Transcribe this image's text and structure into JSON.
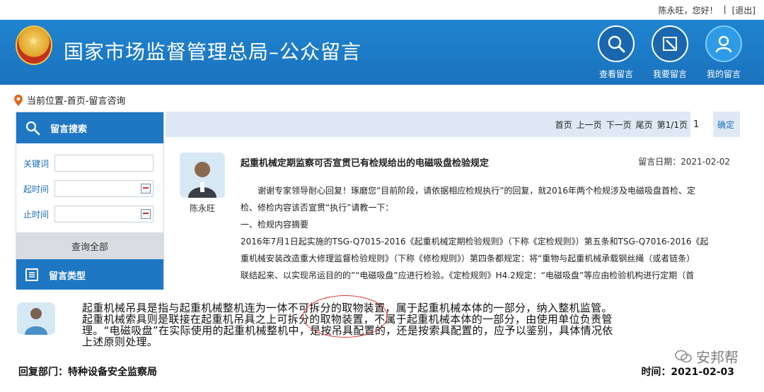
{
  "topbar": {
    "greeting": "陈永旺，您好！",
    "separator": "|",
    "logout": "[退出]"
  },
  "header": {
    "site_title": "国家市场监督管理总局–公众留言",
    "nav": [
      {
        "label": "查看留言",
        "icon": "search-icon"
      },
      {
        "label": "我要留言",
        "icon": "edit-icon"
      },
      {
        "label": "我的留言",
        "icon": "user-icon"
      }
    ]
  },
  "breadcrumb": {
    "text": "当前位置-首页-留言咨询"
  },
  "sidebar": {
    "search_title": "留言搜索",
    "keyword_label": "关键词",
    "start_label": "起时间",
    "end_label": "止时间",
    "query_all": "查询全部",
    "type_title": "留言类型"
  },
  "pager": {
    "first": "首页",
    "prev": "上一页",
    "next": "下一页",
    "last": "尾页",
    "status": "第1/1页",
    "page_value": "1",
    "confirm": "确定"
  },
  "post": {
    "user": "陈永旺",
    "title": "起重机械定期监察可否宣贯已有检规给出的电磁吸盘检验规定",
    "date": "留言日期：2021-02-02",
    "body": [
      "谢谢专家领导耐心回复！琢磨您“目前阶段，请依据相应检规执行”的回复，就2016年两个检规涉及电磁吸盘首检、定",
      "检、修检内容该否宣贯“执行”请教一下：",
      "一、检规内容摘要",
      "2016年7月1日起实施的TSG-Q7015-2016《起重机械定期检验规则》（下称《定检规则》）第五条和TSG-Q7016-2016《起",
      "重机械安装改造重大修理监督检验规则》（下称《修检规则》）第四条都规定：将“重物与起重机械承载钢丝绳（或者链条）",
      "联结起来、以实现吊运目的的”“电磁吸盘”应进行检验。《定检规则》H4.2规定：“电磁吸盘”等应由检验机构进行定期（首"
    ]
  },
  "reply": {
    "lines": [
      "起重机械吊具是指与起重机械整机连为一体不可拆分的取物装置，属于起重机械本体的一部分，纳入整机监管。",
      "起重机械索具则是联接在起重机吊具之上可拆分的取物装置，不属于起重机械本体的一部分，由使用单位负责管",
      "理。“电磁吸盘”在实际使用的起重机械整机中，是按吊具配置的，还是按索具配置的，应予以鉴别，具体情况依",
      "上述原则处理。"
    ],
    "dept": "回复部门：特种设备安全监察局",
    "time": "时间：2021-02-03"
  },
  "watermark": {
    "text": "安邦帮"
  }
}
